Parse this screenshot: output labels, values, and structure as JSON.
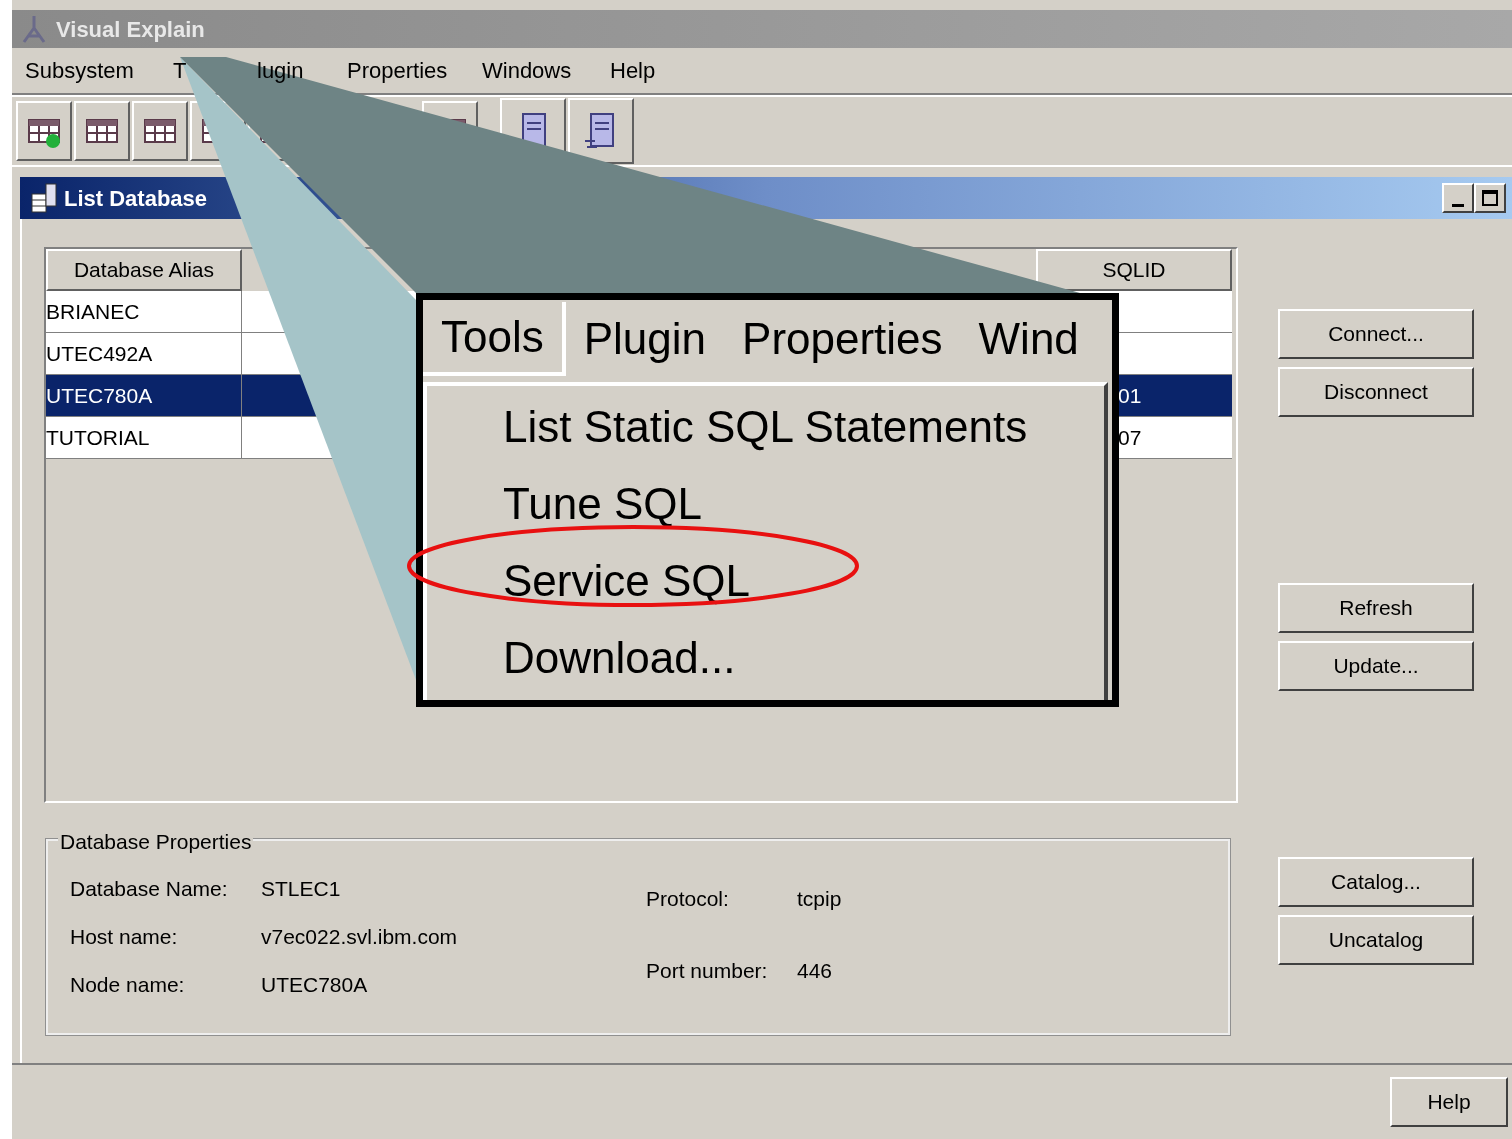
{
  "window": {
    "title": "Visual Explain"
  },
  "menu": [
    {
      "label": "Subsystem"
    },
    {
      "label": "T"
    },
    {
      "label": "lugin"
    },
    {
      "label": "Properties"
    },
    {
      "label": "Windows"
    },
    {
      "label": "Help"
    }
  ],
  "frame": {
    "title": "List Database"
  },
  "table": {
    "columns": [
      {
        "label": "Database Alias"
      },
      {
        "label": "SQLID"
      }
    ],
    "rows": [
      {
        "alias": "BRIANEC",
        "sqlid": "",
        "selected": false
      },
      {
        "alias": "UTEC492A",
        "sqlid": "",
        "selected": false
      },
      {
        "alias": "UTEC780A",
        "sqlid": "01",
        "selected": true
      },
      {
        "alias": "TUTORIAL",
        "sqlid": "07",
        "selected": false
      }
    ]
  },
  "side_buttons": [
    [
      "Connect...",
      "Disconnect"
    ],
    [
      "Refresh",
      "Update..."
    ],
    [
      "Catalog...",
      "Uncatalog"
    ]
  ],
  "properties": {
    "title": "Database Properties",
    "left": [
      {
        "label": "Database Name:",
        "value": "STLEC1"
      },
      {
        "label": "Host name:",
        "value": "v7ec022.svl.ibm.com"
      },
      {
        "label": "Node name:",
        "value": "UTEC780A"
      }
    ],
    "right": [
      {
        "label": "Protocol:",
        "value": "tcpip"
      },
      {
        "label": "Port number:",
        "value": "446"
      }
    ]
  },
  "help_button": "Help",
  "callout": {
    "menu": [
      {
        "label": "Tools",
        "selected": true
      },
      {
        "label": "Plugin",
        "selected": false
      },
      {
        "label": "Properties",
        "selected": false
      },
      {
        "label": "Wind",
        "selected": false
      }
    ],
    "items": [
      {
        "label": "List Static SQL Statements",
        "circled": false
      },
      {
        "label": "Tune SQL",
        "circled": false
      },
      {
        "label": "Service SQL",
        "circled": true
      },
      {
        "label": "Download...",
        "circled": false
      }
    ]
  }
}
